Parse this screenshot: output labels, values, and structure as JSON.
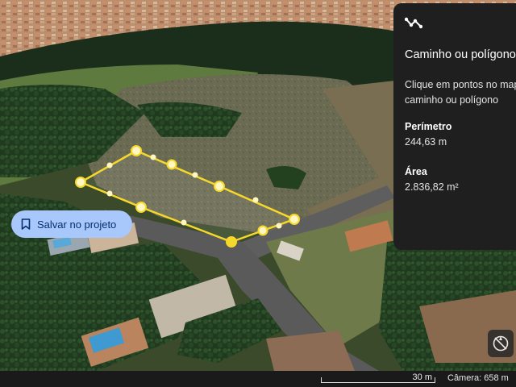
{
  "panel": {
    "tool_icon": "path-polyline-icon",
    "title": "Caminho ou polígono",
    "instruction_line1": "Clique em pontos no mapa",
    "instruction_line2": "caminho ou polígono",
    "perimeter_label": "Perímetro",
    "perimeter_value": "244,63 m",
    "area_label": "Área",
    "area_value": "2.836,82 m²",
    "save_icon": "bookmark-icon",
    "save_label": "Salvar no projeto"
  },
  "map": {
    "compass_icon": "compass-north-icon",
    "scale_label": "30 m",
    "camera_label": "Câmera: 658 m"
  },
  "colors": {
    "polygon": "#f5d82a",
    "panel_bg": "#1f1f1f",
    "button_bg": "#a8c7fa",
    "button_text": "#062e6f"
  }
}
